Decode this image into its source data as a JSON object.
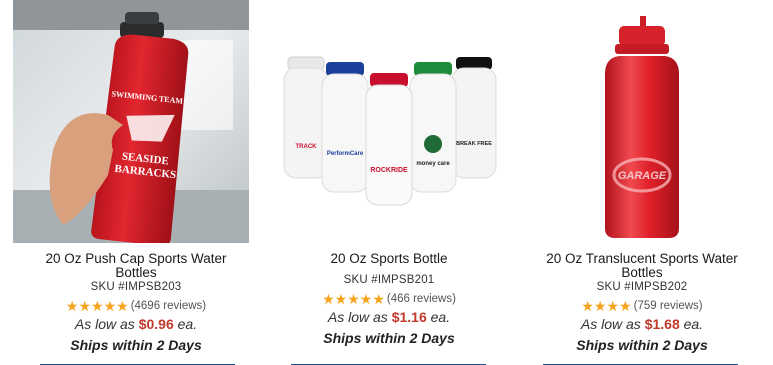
{
  "products": [
    {
      "title": "20 Oz Push Cap Sports Water Bottles",
      "sku": "SKU #IMPSB203",
      "stars": 5,
      "reviews": "(4696 reviews)",
      "price_prefix": "As low as",
      "price": "$0.96",
      "price_suffix": "ea.",
      "ships": "Ships within 2 Days",
      "image_text": [
        "SWIMMING TEAM",
        "SEASIDE",
        "BARRACKS"
      ],
      "bottle_color": "#d7232c"
    },
    {
      "title": "20 Oz Sports Bottle",
      "sku": "SKU #IMPSB201",
      "stars": 5,
      "reviews": "(466 reviews)",
      "price_prefix": "As low as",
      "price": "$1.16",
      "price_suffix": "ea.",
      "ships": "Ships within 2 Days",
      "image_text": [
        "TRACK",
        "PerformCare",
        "ROCKRIDE",
        "money care",
        "BREAK FREE"
      ],
      "cap_colors": [
        "#e6e6e6",
        "#1b3f9c",
        "#c8102e",
        "#1e8c3a",
        "#111111"
      ]
    },
    {
      "title": "20 Oz Translucent Sports Water Bottles",
      "sku": "SKU #IMPSB202",
      "stars": 4,
      "reviews": "(759 reviews)",
      "price_prefix": "As low as",
      "price": "$1.68",
      "price_suffix": "ea.",
      "ships": "Ships within 2 Days",
      "image_text": [
        "GARAGE"
      ],
      "bottle_color": "#e0202a"
    }
  ]
}
